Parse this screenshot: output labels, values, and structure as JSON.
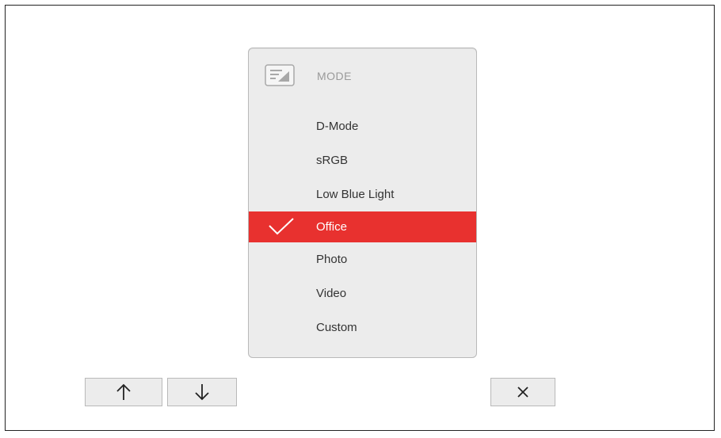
{
  "osd": {
    "title": "MODE",
    "icon": "display-mode-icon",
    "items": [
      {
        "label": "D-Mode",
        "selected": false
      },
      {
        "label": "sRGB",
        "selected": false
      },
      {
        "label": "Low Blue Light",
        "selected": false
      },
      {
        "label": "Office",
        "selected": true
      },
      {
        "label": "Photo",
        "selected": false
      },
      {
        "label": "Video",
        "selected": false
      },
      {
        "label": "Custom",
        "selected": false
      }
    ],
    "selected_color": "#e8312f",
    "panel_color": "#ececec"
  },
  "buttons": {
    "up_icon": "arrow-up-icon",
    "down_icon": "arrow-down-icon",
    "close_icon": "close-icon"
  }
}
